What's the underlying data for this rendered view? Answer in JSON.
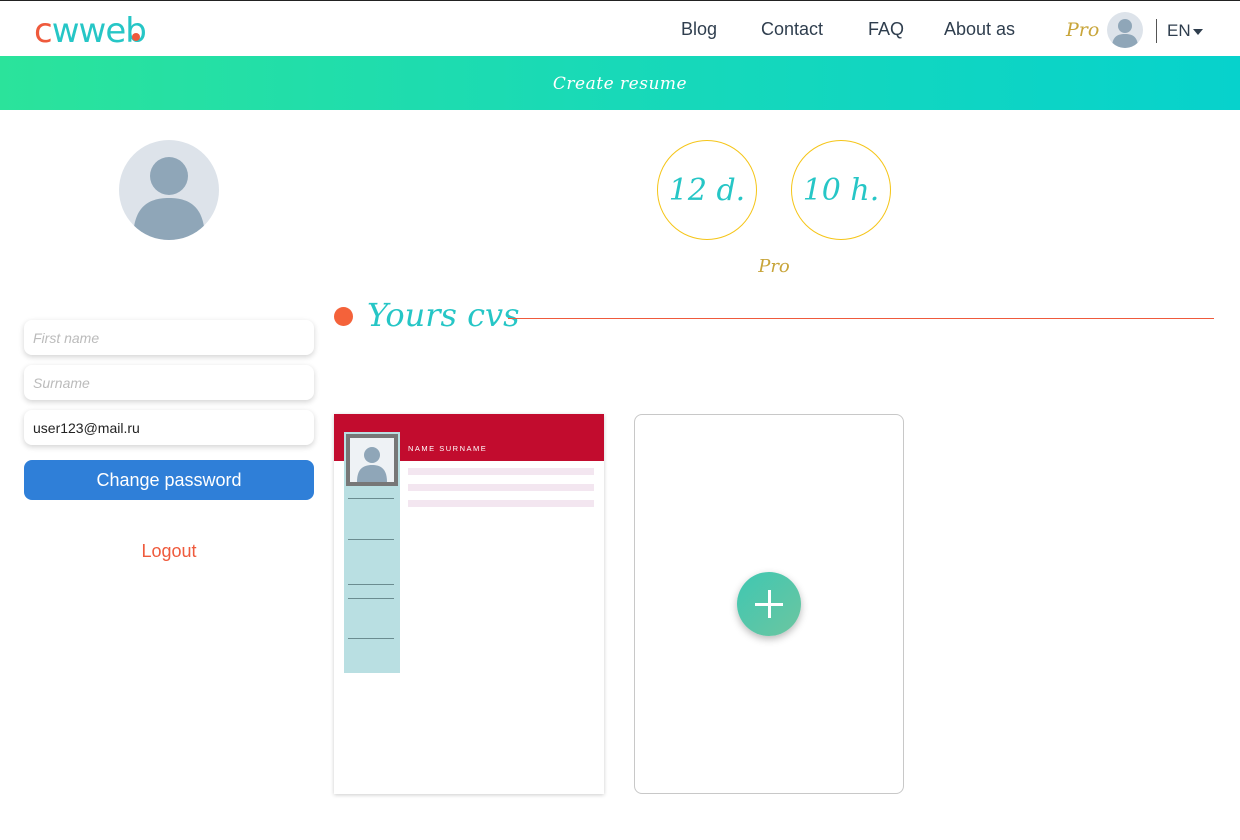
{
  "header": {
    "logo": {
      "c": "c",
      "w": "w",
      "rest": "web"
    },
    "nav": [
      {
        "label": "Blog"
      },
      {
        "label": "Contact"
      },
      {
        "label": "FAQ"
      },
      {
        "label": "About as"
      }
    ],
    "pro_label": "Pro",
    "language": "EN"
  },
  "banner": {
    "label": "Create resume"
  },
  "subscription": {
    "days": "12 d.",
    "hours": "10 h.",
    "plan": "Pro"
  },
  "profile": {
    "first_name_placeholder": "First name",
    "surname_placeholder": "Surname",
    "email_value": "user123@mail.ru",
    "change_password_label": "Change password",
    "logout_label": "Logout"
  },
  "cvs": {
    "title": "Yours cvs",
    "cards": [
      {
        "name": "NAME SURNAME"
      }
    ]
  },
  "colors": {
    "accent_teal": "#26c6c6",
    "accent_orange": "#ef5a3c",
    "pro_gold": "#c8a53a",
    "primary_blue": "#2f7fd8",
    "cv_header_red": "#c20c2e"
  },
  "icons": {
    "avatar": "user-silhouette-icon",
    "add": "plus-icon",
    "language_caret": "caret-down-icon"
  }
}
